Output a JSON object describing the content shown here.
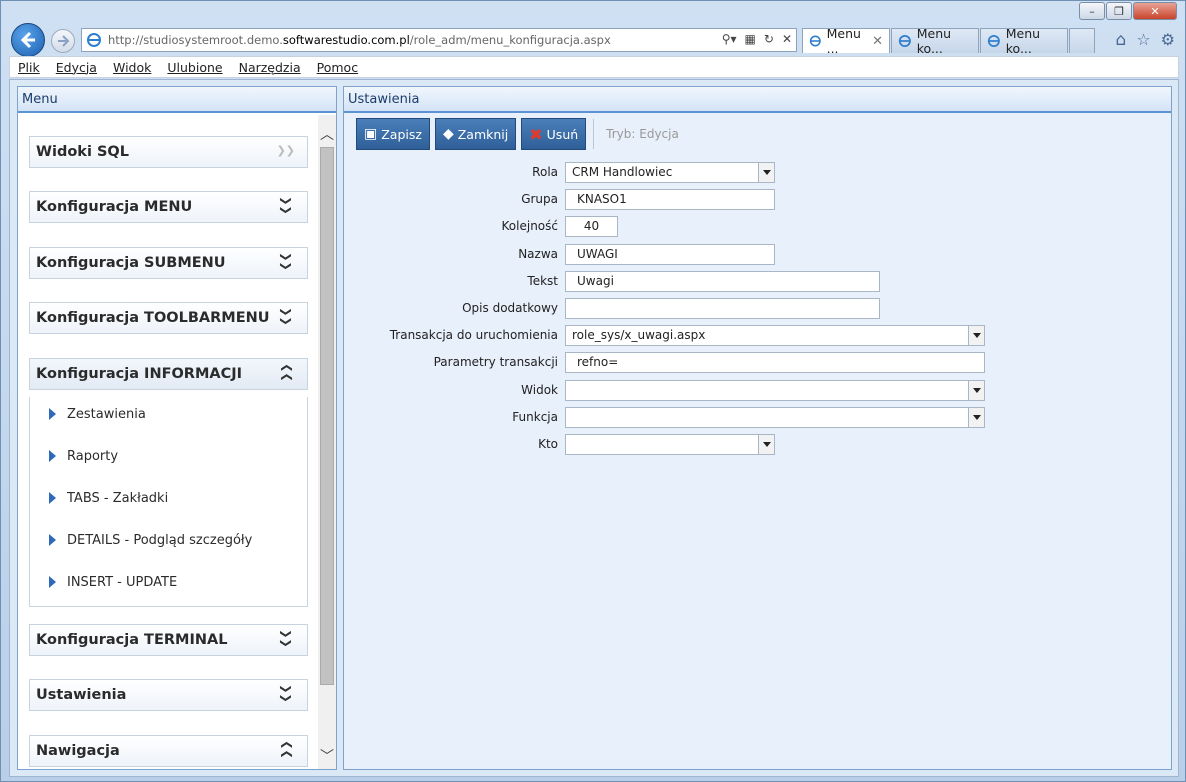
{
  "browser": {
    "url_prefix": "http://studiosystemroot.demo.",
    "url_domain": "softwarestudio.com.pl",
    "url_path": "/role_adm/menu_konfiguracja.aspx",
    "tabs": [
      {
        "label": "Menu ..."
      },
      {
        "label": "Menu ko..."
      },
      {
        "label": "Menu ko..."
      }
    ],
    "menu": [
      "Plik",
      "Edycja",
      "Widok",
      "Ulubione",
      "Narzędzia",
      "Pomoc"
    ]
  },
  "left_panel": {
    "title": "Menu",
    "sections": [
      {
        "label": "Widoki SQL"
      },
      {
        "label": "Konfiguracja MENU"
      },
      {
        "label": "Konfiguracja SUBMENU"
      },
      {
        "label": "Konfiguracja TOOLBARMENU"
      },
      {
        "label": "Konfiguracja INFORMACJI"
      },
      {
        "label": "Konfiguracja TERMINAL"
      },
      {
        "label": "Ustawienia"
      },
      {
        "label": "Nawigacja"
      }
    ],
    "open_items": [
      "Zestawienia",
      "Raporty",
      "TABS - Zakładki",
      "DETAILS - Podgląd szczegóły",
      "INSERT - UPDATE"
    ]
  },
  "right_panel": {
    "title": "Ustawienia",
    "toolbar": {
      "save": "Zapisz",
      "close": "Zamknij",
      "delete": "Usuń",
      "mode": "Tryb: Edycja"
    },
    "form": {
      "rola": {
        "label": "Rola",
        "value": "CRM Handlowiec"
      },
      "grupa": {
        "label": "Grupa",
        "value": "KNASO1"
      },
      "kolejnosc": {
        "label": "Kolejność",
        "value": "40"
      },
      "nazwa": {
        "label": "Nazwa",
        "value": "UWAGI"
      },
      "tekst": {
        "label": "Tekst",
        "value": "Uwagi"
      },
      "opis": {
        "label": "Opis dodatkowy",
        "value": ""
      },
      "transakcja": {
        "label": "Transakcja do uruchomienia",
        "value": "role_sys/x_uwagi.aspx"
      },
      "parametry": {
        "label": "Parametry transakcji",
        "value": "refno="
      },
      "widok": {
        "label": "Widok",
        "value": ""
      },
      "funkcja": {
        "label": "Funkcja",
        "value": ""
      },
      "kto": {
        "label": "Kto",
        "value": ""
      }
    }
  },
  "colors": {
    "accent": "#2f5f98",
    "header_border": "#5b93d3",
    "panel_bg": "#e7f0fb"
  }
}
